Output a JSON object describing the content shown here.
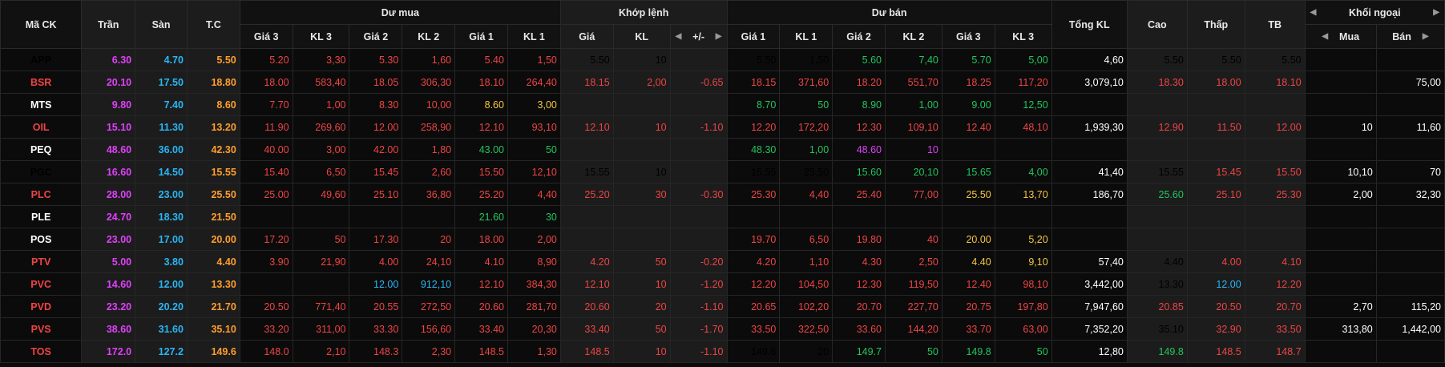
{
  "colors": {
    "ceiling": "#e040fb",
    "floor": "#29b6f6",
    "reference": "#ff9e2c",
    "up": "#22c55e",
    "down": "#ef4444",
    "neutral": "#ffffff",
    "ref_yellow": "#f5c542"
  },
  "headers": {
    "symbol": "Mã CK",
    "ceiling": "Trần",
    "floor": "Sàn",
    "ref": "T.C",
    "bid_group": "Dư mua",
    "match_group": "Khớp lệnh",
    "ask_group": "Dư bán",
    "total_vol": "Tổng KL",
    "high": "Cao",
    "low": "Thấp",
    "avg": "TB",
    "foreign_group": "Khối ngoại",
    "bid_cols": [
      "Giá 3",
      "KL 3",
      "Giá 2",
      "KL 2",
      "Giá 1",
      "KL 1"
    ],
    "match_cols": [
      "Giá",
      "KL",
      "+/-"
    ],
    "ask_cols": [
      "Giá 1",
      "KL 1",
      "Giá 2",
      "KL 2",
      "Giá 3",
      "KL 3"
    ],
    "foreign_cols": [
      "Mua",
      "Bán"
    ],
    "arrow_left": "◀",
    "arrow_right": "▶"
  },
  "rows": [
    {
      "sym": "APP",
      "symc": "ref",
      "cei": "6.30",
      "flo": "4.70",
      "ref": "5.50",
      "b": [
        [
          "5.20",
          "down"
        ],
        [
          "3,30",
          "down"
        ],
        [
          "5.30",
          "down"
        ],
        [
          "1,60",
          "down"
        ],
        [
          "5.40",
          "down"
        ],
        [
          "1,50",
          "down"
        ]
      ],
      "m": [
        [
          "5.50",
          "ref"
        ],
        [
          "10",
          "ref"
        ],
        [
          "",
          ""
        ]
      ],
      "a": [
        [
          "5.50",
          "ref"
        ],
        [
          "1,50",
          "ref"
        ],
        [
          "5.60",
          "up"
        ],
        [
          "7,40",
          "up"
        ],
        [
          "5.70",
          "up"
        ],
        [
          "5,00",
          "up"
        ]
      ],
      "tot": "4,60",
      "hi": [
        "5.50",
        "ref"
      ],
      "lo": [
        "5.50",
        "ref"
      ],
      "avg": [
        "5.50",
        "ref"
      ],
      "fb": "",
      "fs": ""
    },
    {
      "sym": "BSR",
      "symc": "down",
      "cei": "20.10",
      "flo": "17.50",
      "ref": "18.80",
      "b": [
        [
          "18.00",
          "down"
        ],
        [
          "583,40",
          "down"
        ],
        [
          "18.05",
          "down"
        ],
        [
          "306,30",
          "down"
        ],
        [
          "18.10",
          "down"
        ],
        [
          "264,40",
          "down"
        ]
      ],
      "m": [
        [
          "18.15",
          "down"
        ],
        [
          "2,00",
          "down"
        ],
        [
          "-0.65",
          "down"
        ]
      ],
      "a": [
        [
          "18.15",
          "down"
        ],
        [
          "371,60",
          "down"
        ],
        [
          "18.20",
          "down"
        ],
        [
          "551,70",
          "down"
        ],
        [
          "18.25",
          "down"
        ],
        [
          "117,20",
          "down"
        ]
      ],
      "tot": "3,079,10",
      "hi": [
        "18.30",
        "down"
      ],
      "lo": [
        "18.00",
        "down"
      ],
      "avg": [
        "18.10",
        "down"
      ],
      "fb": "",
      "fs": "75,00"
    },
    {
      "sym": "MTS",
      "symc": "neutral",
      "cei": "9.80",
      "flo": "7.40",
      "ref": "8.60",
      "b": [
        [
          "7.70",
          "down"
        ],
        [
          "1,00",
          "down"
        ],
        [
          "8.30",
          "down"
        ],
        [
          "10,00",
          "down"
        ],
        [
          "8.60",
          "ref_yellow"
        ],
        [
          "3,00",
          "ref_yellow"
        ]
      ],
      "m": [
        [
          "",
          ""
        ],
        [
          "",
          ""
        ],
        [
          "",
          ""
        ]
      ],
      "a": [
        [
          "8.70",
          "up"
        ],
        [
          "50",
          "up"
        ],
        [
          "8.90",
          "up"
        ],
        [
          "1,00",
          "up"
        ],
        [
          "9.00",
          "up"
        ],
        [
          "12,50",
          "up"
        ]
      ],
      "tot": "",
      "hi": [
        "",
        ""
      ],
      "lo": [
        "",
        ""
      ],
      "avg": [
        "",
        ""
      ],
      "fb": "",
      "fs": ""
    },
    {
      "sym": "OIL",
      "symc": "down",
      "cei": "15.10",
      "flo": "11.30",
      "ref": "13.20",
      "b": [
        [
          "11.90",
          "down"
        ],
        [
          "269,60",
          "down"
        ],
        [
          "12.00",
          "down"
        ],
        [
          "258,90",
          "down"
        ],
        [
          "12.10",
          "down"
        ],
        [
          "93,10",
          "down"
        ]
      ],
      "m": [
        [
          "12.10",
          "down"
        ],
        [
          "10",
          "down"
        ],
        [
          "-1.10",
          "down"
        ]
      ],
      "a": [
        [
          "12.20",
          "down"
        ],
        [
          "172,20",
          "down"
        ],
        [
          "12.30",
          "down"
        ],
        [
          "109,10",
          "down"
        ],
        [
          "12.40",
          "down"
        ],
        [
          "48,10",
          "down"
        ]
      ],
      "tot": "1,939,30",
      "hi": [
        "12.90",
        "down"
      ],
      "lo": [
        "11.50",
        "down"
      ],
      "avg": [
        "12.00",
        "down"
      ],
      "fb": "10",
      "fs": "11,60"
    },
    {
      "sym": "PEQ",
      "symc": "neutral",
      "cei": "48.60",
      "flo": "36.00",
      "ref": "42.30",
      "b": [
        [
          "40.00",
          "down"
        ],
        [
          "3,00",
          "down"
        ],
        [
          "42.00",
          "down"
        ],
        [
          "1,80",
          "down"
        ],
        [
          "43.00",
          "up"
        ],
        [
          "50",
          "up"
        ]
      ],
      "m": [
        [
          "",
          ""
        ],
        [
          "",
          ""
        ],
        [
          "",
          ""
        ]
      ],
      "a": [
        [
          "48.30",
          "up"
        ],
        [
          "1,00",
          "up"
        ],
        [
          "48.60",
          "ceiling"
        ],
        [
          "10",
          "ceiling"
        ],
        [
          "",
          ""
        ],
        [
          "",
          ""
        ]
      ],
      "tot": "",
      "hi": [
        "",
        ""
      ],
      "lo": [
        "",
        ""
      ],
      "avg": [
        "",
        ""
      ],
      "fb": "",
      "fs": ""
    },
    {
      "sym": "PGC",
      "symc": "ref",
      "cei": "16.60",
      "flo": "14.50",
      "ref": "15.55",
      "b": [
        [
          "15.40",
          "down"
        ],
        [
          "6,50",
          "down"
        ],
        [
          "15.45",
          "down"
        ],
        [
          "2,60",
          "down"
        ],
        [
          "15.50",
          "down"
        ],
        [
          "12,10",
          "down"
        ]
      ],
      "m": [
        [
          "15.55",
          "ref"
        ],
        [
          "10",
          "ref"
        ],
        [
          "",
          ""
        ]
      ],
      "a": [
        [
          "15.55",
          "ref"
        ],
        [
          "25,50",
          "ref"
        ],
        [
          "15.60",
          "up"
        ],
        [
          "20,10",
          "up"
        ],
        [
          "15.65",
          "up"
        ],
        [
          "4,00",
          "up"
        ]
      ],
      "tot": "41,40",
      "hi": [
        "15.55",
        "ref"
      ],
      "lo": [
        "15.45",
        "down"
      ],
      "avg": [
        "15.50",
        "down"
      ],
      "fb": "10,10",
      "fs": "70"
    },
    {
      "sym": "PLC",
      "symc": "down",
      "cei": "28.00",
      "flo": "23.00",
      "ref": "25.50",
      "b": [
        [
          "25.00",
          "down"
        ],
        [
          "49,60",
          "down"
        ],
        [
          "25.10",
          "down"
        ],
        [
          "36,80",
          "down"
        ],
        [
          "25.20",
          "down"
        ],
        [
          "4,40",
          "down"
        ]
      ],
      "m": [
        [
          "25.20",
          "down"
        ],
        [
          "30",
          "down"
        ],
        [
          "-0.30",
          "down"
        ]
      ],
      "a": [
        [
          "25.30",
          "down"
        ],
        [
          "4,40",
          "down"
        ],
        [
          "25.40",
          "down"
        ],
        [
          "77,00",
          "down"
        ],
        [
          "25.50",
          "ref_yellow"
        ],
        [
          "13,70",
          "ref_yellow"
        ]
      ],
      "tot": "186,70",
      "hi": [
        "25.60",
        "up"
      ],
      "lo": [
        "25.10",
        "down"
      ],
      "avg": [
        "25.30",
        "down"
      ],
      "fb": "2,00",
      "fs": "32,30"
    },
    {
      "sym": "PLE",
      "symc": "neutral",
      "cei": "24.70",
      "flo": "18.30",
      "ref": "21.50",
      "b": [
        [
          "",
          ""
        ],
        [
          "",
          ""
        ],
        [
          "",
          ""
        ],
        [
          "",
          ""
        ],
        [
          "21.60",
          "up"
        ],
        [
          "30",
          "up"
        ]
      ],
      "m": [
        [
          "",
          ""
        ],
        [
          "",
          ""
        ],
        [
          "",
          ""
        ]
      ],
      "a": [
        [
          "",
          ""
        ],
        [
          "",
          ""
        ],
        [
          "",
          ""
        ],
        [
          "",
          ""
        ],
        [
          "",
          ""
        ],
        [
          "",
          ""
        ]
      ],
      "tot": "",
      "hi": [
        "",
        ""
      ],
      "lo": [
        "",
        ""
      ],
      "avg": [
        "",
        ""
      ],
      "fb": "",
      "fs": ""
    },
    {
      "sym": "POS",
      "symc": "neutral",
      "cei": "23.00",
      "flo": "17.00",
      "ref": "20.00",
      "b": [
        [
          "17.20",
          "down"
        ],
        [
          "50",
          "down"
        ],
        [
          "17.30",
          "down"
        ],
        [
          "20",
          "down"
        ],
        [
          "18.00",
          "down"
        ],
        [
          "2,00",
          "down"
        ]
      ],
      "m": [
        [
          "",
          ""
        ],
        [
          "",
          ""
        ],
        [
          "",
          ""
        ]
      ],
      "a": [
        [
          "19.70",
          "down"
        ],
        [
          "6,50",
          "down"
        ],
        [
          "19.80",
          "down"
        ],
        [
          "40",
          "down"
        ],
        [
          "20.00",
          "ref_yellow"
        ],
        [
          "5,20",
          "ref_yellow"
        ]
      ],
      "tot": "",
      "hi": [
        "",
        ""
      ],
      "lo": [
        "",
        ""
      ],
      "avg": [
        "",
        ""
      ],
      "fb": "",
      "fs": ""
    },
    {
      "sym": "PTV",
      "symc": "down",
      "cei": "5.00",
      "flo": "3.80",
      "ref": "4.40",
      "b": [
        [
          "3.90",
          "down"
        ],
        [
          "21,90",
          "down"
        ],
        [
          "4.00",
          "down"
        ],
        [
          "24,10",
          "down"
        ],
        [
          "4.10",
          "down"
        ],
        [
          "8,90",
          "down"
        ]
      ],
      "m": [
        [
          "4.20",
          "down"
        ],
        [
          "50",
          "down"
        ],
        [
          "-0.20",
          "down"
        ]
      ],
      "a": [
        [
          "4.20",
          "down"
        ],
        [
          "1,10",
          "down"
        ],
        [
          "4.30",
          "down"
        ],
        [
          "2,50",
          "down"
        ],
        [
          "4.40",
          "ref_yellow"
        ],
        [
          "9,10",
          "ref_yellow"
        ]
      ],
      "tot": "57,40",
      "hi": [
        "4.40",
        "ref"
      ],
      "lo": [
        "4.00",
        "down"
      ],
      "avg": [
        "4.10",
        "down"
      ],
      "fb": "",
      "fs": ""
    },
    {
      "sym": "PVC",
      "symc": "down",
      "cei": "14.60",
      "flo": "12.00",
      "ref": "13.30",
      "b": [
        [
          "",
          ""
        ],
        [
          "",
          ""
        ],
        [
          "12.00",
          "floor"
        ],
        [
          "912,10",
          "floor"
        ],
        [
          "12.10",
          "down"
        ],
        [
          "384,30",
          "down"
        ]
      ],
      "m": [
        [
          "12.10",
          "down"
        ],
        [
          "10",
          "down"
        ],
        [
          "-1.20",
          "down"
        ]
      ],
      "a": [
        [
          "12.20",
          "down"
        ],
        [
          "104,50",
          "down"
        ],
        [
          "12.30",
          "down"
        ],
        [
          "119,50",
          "down"
        ],
        [
          "12.40",
          "down"
        ],
        [
          "98,10",
          "down"
        ]
      ],
      "tot": "3,442,00",
      "hi": [
        "13.30",
        "ref"
      ],
      "lo": [
        "12.00",
        "floor"
      ],
      "avg": [
        "12.20",
        "down"
      ],
      "fb": "",
      "fs": ""
    },
    {
      "sym": "PVD",
      "symc": "down",
      "cei": "23.20",
      "flo": "20.20",
      "ref": "21.70",
      "b": [
        [
          "20.50",
          "down"
        ],
        [
          "771,40",
          "down"
        ],
        [
          "20.55",
          "down"
        ],
        [
          "272,50",
          "down"
        ],
        [
          "20.60",
          "down"
        ],
        [
          "281,70",
          "down"
        ]
      ],
      "m": [
        [
          "20.60",
          "down"
        ],
        [
          "20",
          "down"
        ],
        [
          "-1.10",
          "down"
        ]
      ],
      "a": [
        [
          "20.65",
          "down"
        ],
        [
          "102,20",
          "down"
        ],
        [
          "20.70",
          "down"
        ],
        [
          "227,70",
          "down"
        ],
        [
          "20.75",
          "down"
        ],
        [
          "197,80",
          "down"
        ]
      ],
      "tot": "7,947,60",
      "hi": [
        "20.85",
        "down"
      ],
      "lo": [
        "20.50",
        "down"
      ],
      "avg": [
        "20.70",
        "down"
      ],
      "fb": "2,70",
      "fs": "115,20"
    },
    {
      "sym": "PVS",
      "symc": "down",
      "cei": "38.60",
      "flo": "31.60",
      "ref": "35.10",
      "b": [
        [
          "33.20",
          "down"
        ],
        [
          "311,00",
          "down"
        ],
        [
          "33.30",
          "down"
        ],
        [
          "156,60",
          "down"
        ],
        [
          "33.40",
          "down"
        ],
        [
          "20,30",
          "down"
        ]
      ],
      "m": [
        [
          "33.40",
          "down"
        ],
        [
          "50",
          "down"
        ],
        [
          "-1.70",
          "down"
        ]
      ],
      "a": [
        [
          "33.50",
          "down"
        ],
        [
          "322,50",
          "down"
        ],
        [
          "33.60",
          "down"
        ],
        [
          "144,20",
          "down"
        ],
        [
          "33.70",
          "down"
        ],
        [
          "63,00",
          "down"
        ]
      ],
      "tot": "7,352,20",
      "hi": [
        "35.10",
        "ref"
      ],
      "lo": [
        "32.90",
        "down"
      ],
      "avg": [
        "33.50",
        "down"
      ],
      "fb": "313,80",
      "fs": "1,442,00"
    },
    {
      "sym": "TOS",
      "symc": "down",
      "cei": "172.0",
      "flo": "127.2",
      "ref": "149.6",
      "b": [
        [
          "148.0",
          "down"
        ],
        [
          "2,10",
          "down"
        ],
        [
          "148.3",
          "down"
        ],
        [
          "2,30",
          "down"
        ],
        [
          "148.5",
          "down"
        ],
        [
          "1,30",
          "down"
        ]
      ],
      "m": [
        [
          "148.5",
          "down"
        ],
        [
          "10",
          "down"
        ],
        [
          "-1.10",
          "down"
        ]
      ],
      "a": [
        [
          "149.6",
          "ref"
        ],
        [
          "20",
          "ref"
        ],
        [
          "149.7",
          "up"
        ],
        [
          "50",
          "up"
        ],
        [
          "149.8",
          "up"
        ],
        [
          "50",
          "up"
        ]
      ],
      "tot": "12,80",
      "hi": [
        "149.8",
        "up"
      ],
      "lo": [
        "148.5",
        "down"
      ],
      "avg": [
        "148.7",
        "down"
      ],
      "fb": "",
      "fs": ""
    }
  ]
}
